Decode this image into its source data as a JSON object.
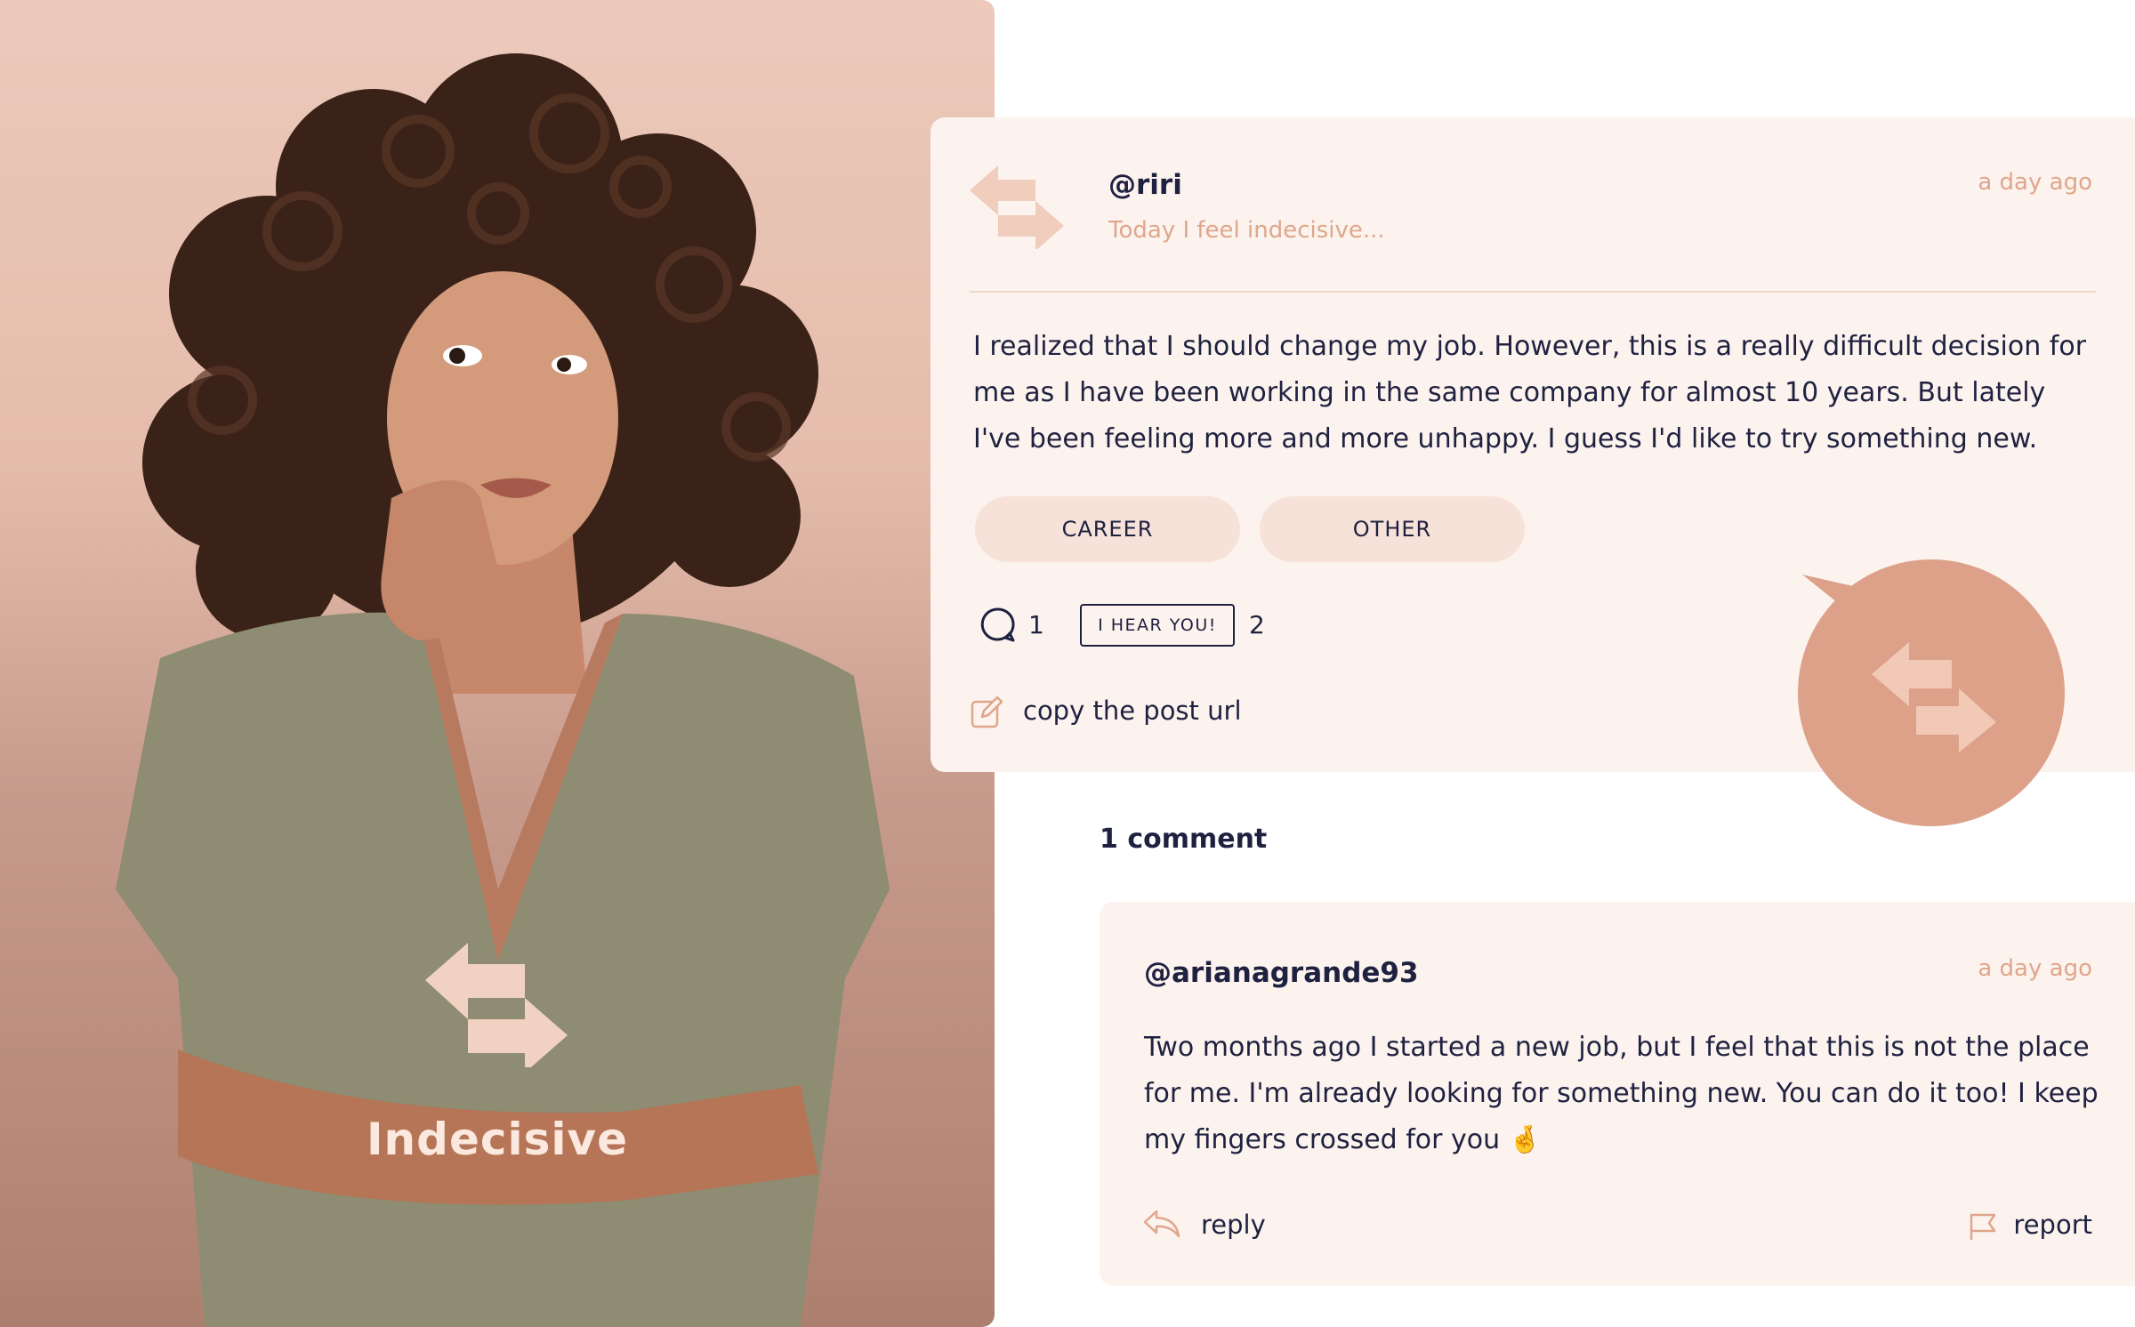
{
  "hero": {
    "label": "Indecisive"
  },
  "post": {
    "username": "@riri",
    "mood": "Today I feel indecisive...",
    "timestamp": "a day ago",
    "body": "I realized that I should change my job. However, this is a really difficult decision for me as I have been working in the same company for almost 10 years. But lately I've been feeling more and more unhappy. I guess I'd like to try something new.",
    "tags": [
      "CAREER",
      "OTHER"
    ],
    "comment_count": "1",
    "hear_label": "I HEAR YOU!",
    "hear_count": "2",
    "copy_link": "copy the post url"
  },
  "comments": {
    "heading": "1 comment",
    "items": [
      {
        "username": "@arianagrande93",
        "timestamp": "a day ago",
        "body": "Two months ago I started a new job, but I feel that this is not the place for me. I'm already looking for something new. You can do it too! I keep my fingers crossed for you 🤞",
        "reply_label": "reply",
        "report_label": "report"
      }
    ]
  },
  "colors": {
    "accent": "#e0a68b",
    "card_background": "#fcf3ee",
    "tag_background": "#f6e2d8",
    "bubble": "#dda189",
    "text": "#1f2140"
  },
  "icons": [
    "arrows-exchange-icon",
    "comment-icon",
    "edit-link-icon",
    "reply-icon",
    "flag-icon",
    "speech-bubble-icon"
  ]
}
